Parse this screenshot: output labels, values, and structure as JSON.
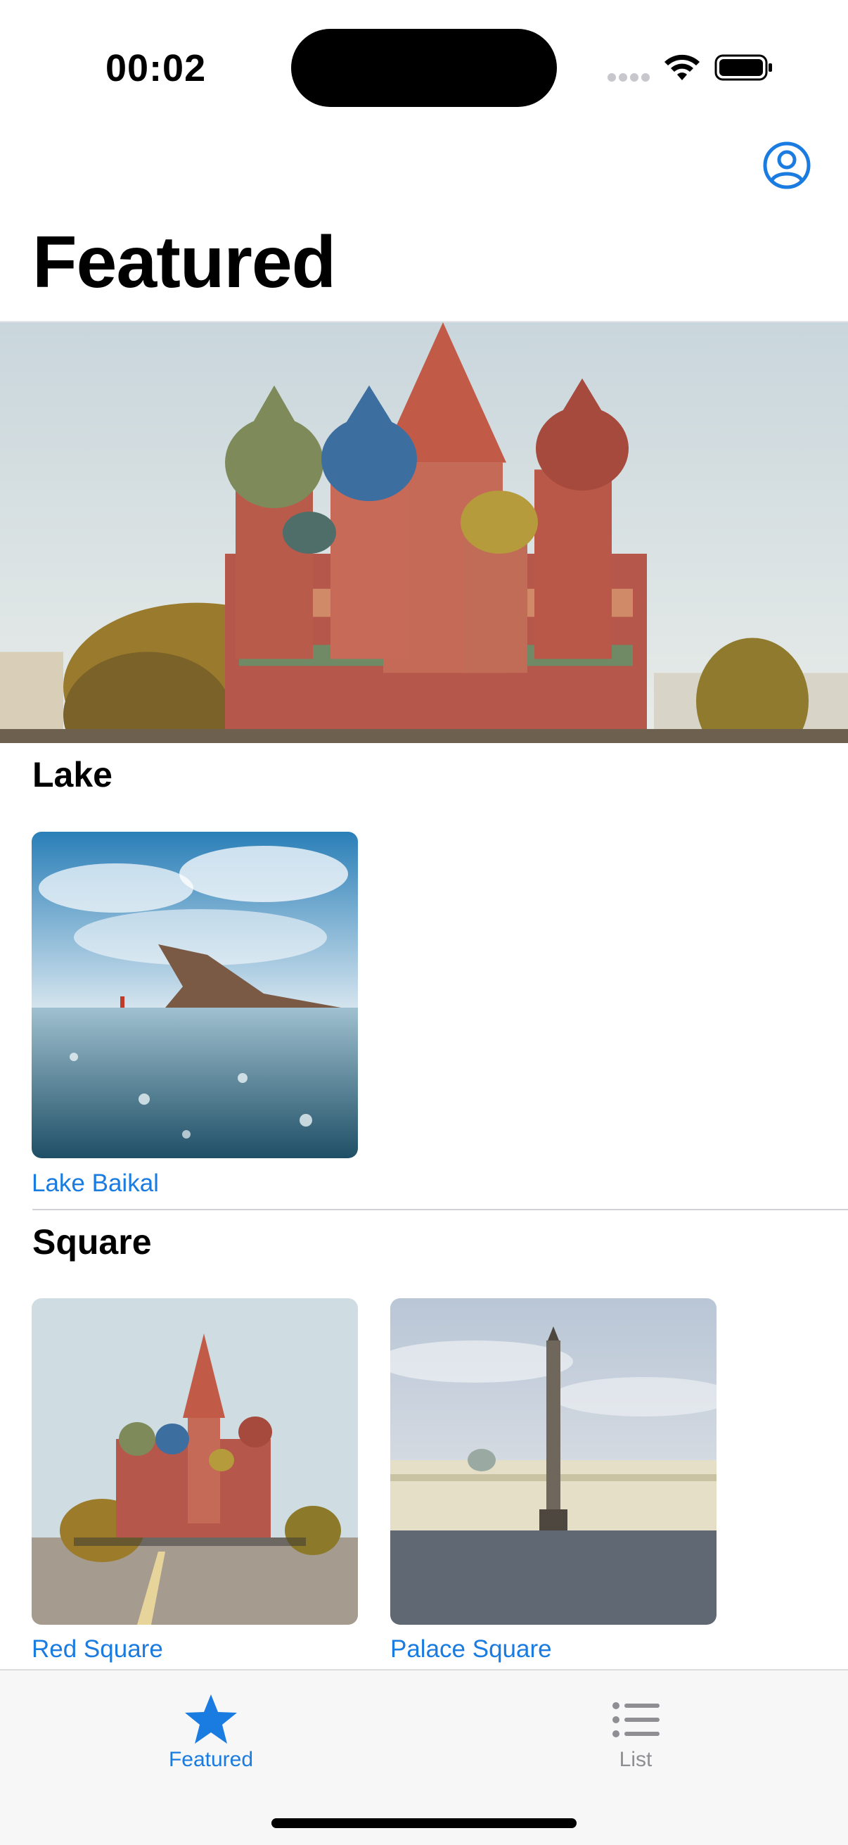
{
  "status": {
    "time": "00:02"
  },
  "nav": {
    "title": "Featured"
  },
  "sections": [
    {
      "title": "Lake",
      "items": [
        {
          "label": "Lake Baikal"
        }
      ]
    },
    {
      "title": "Square",
      "items": [
        {
          "label": "Red Square"
        },
        {
          "label": "Palace Square"
        }
      ]
    }
  ],
  "tabs": [
    {
      "label": "Featured",
      "icon": "star-icon",
      "selected": true
    },
    {
      "label": "List",
      "icon": "list-icon",
      "selected": false
    }
  ],
  "colors": {
    "accent": "#1a7be0",
    "inactive": "#8e8e93",
    "tab_bar_bg": "#f7f7f7"
  }
}
